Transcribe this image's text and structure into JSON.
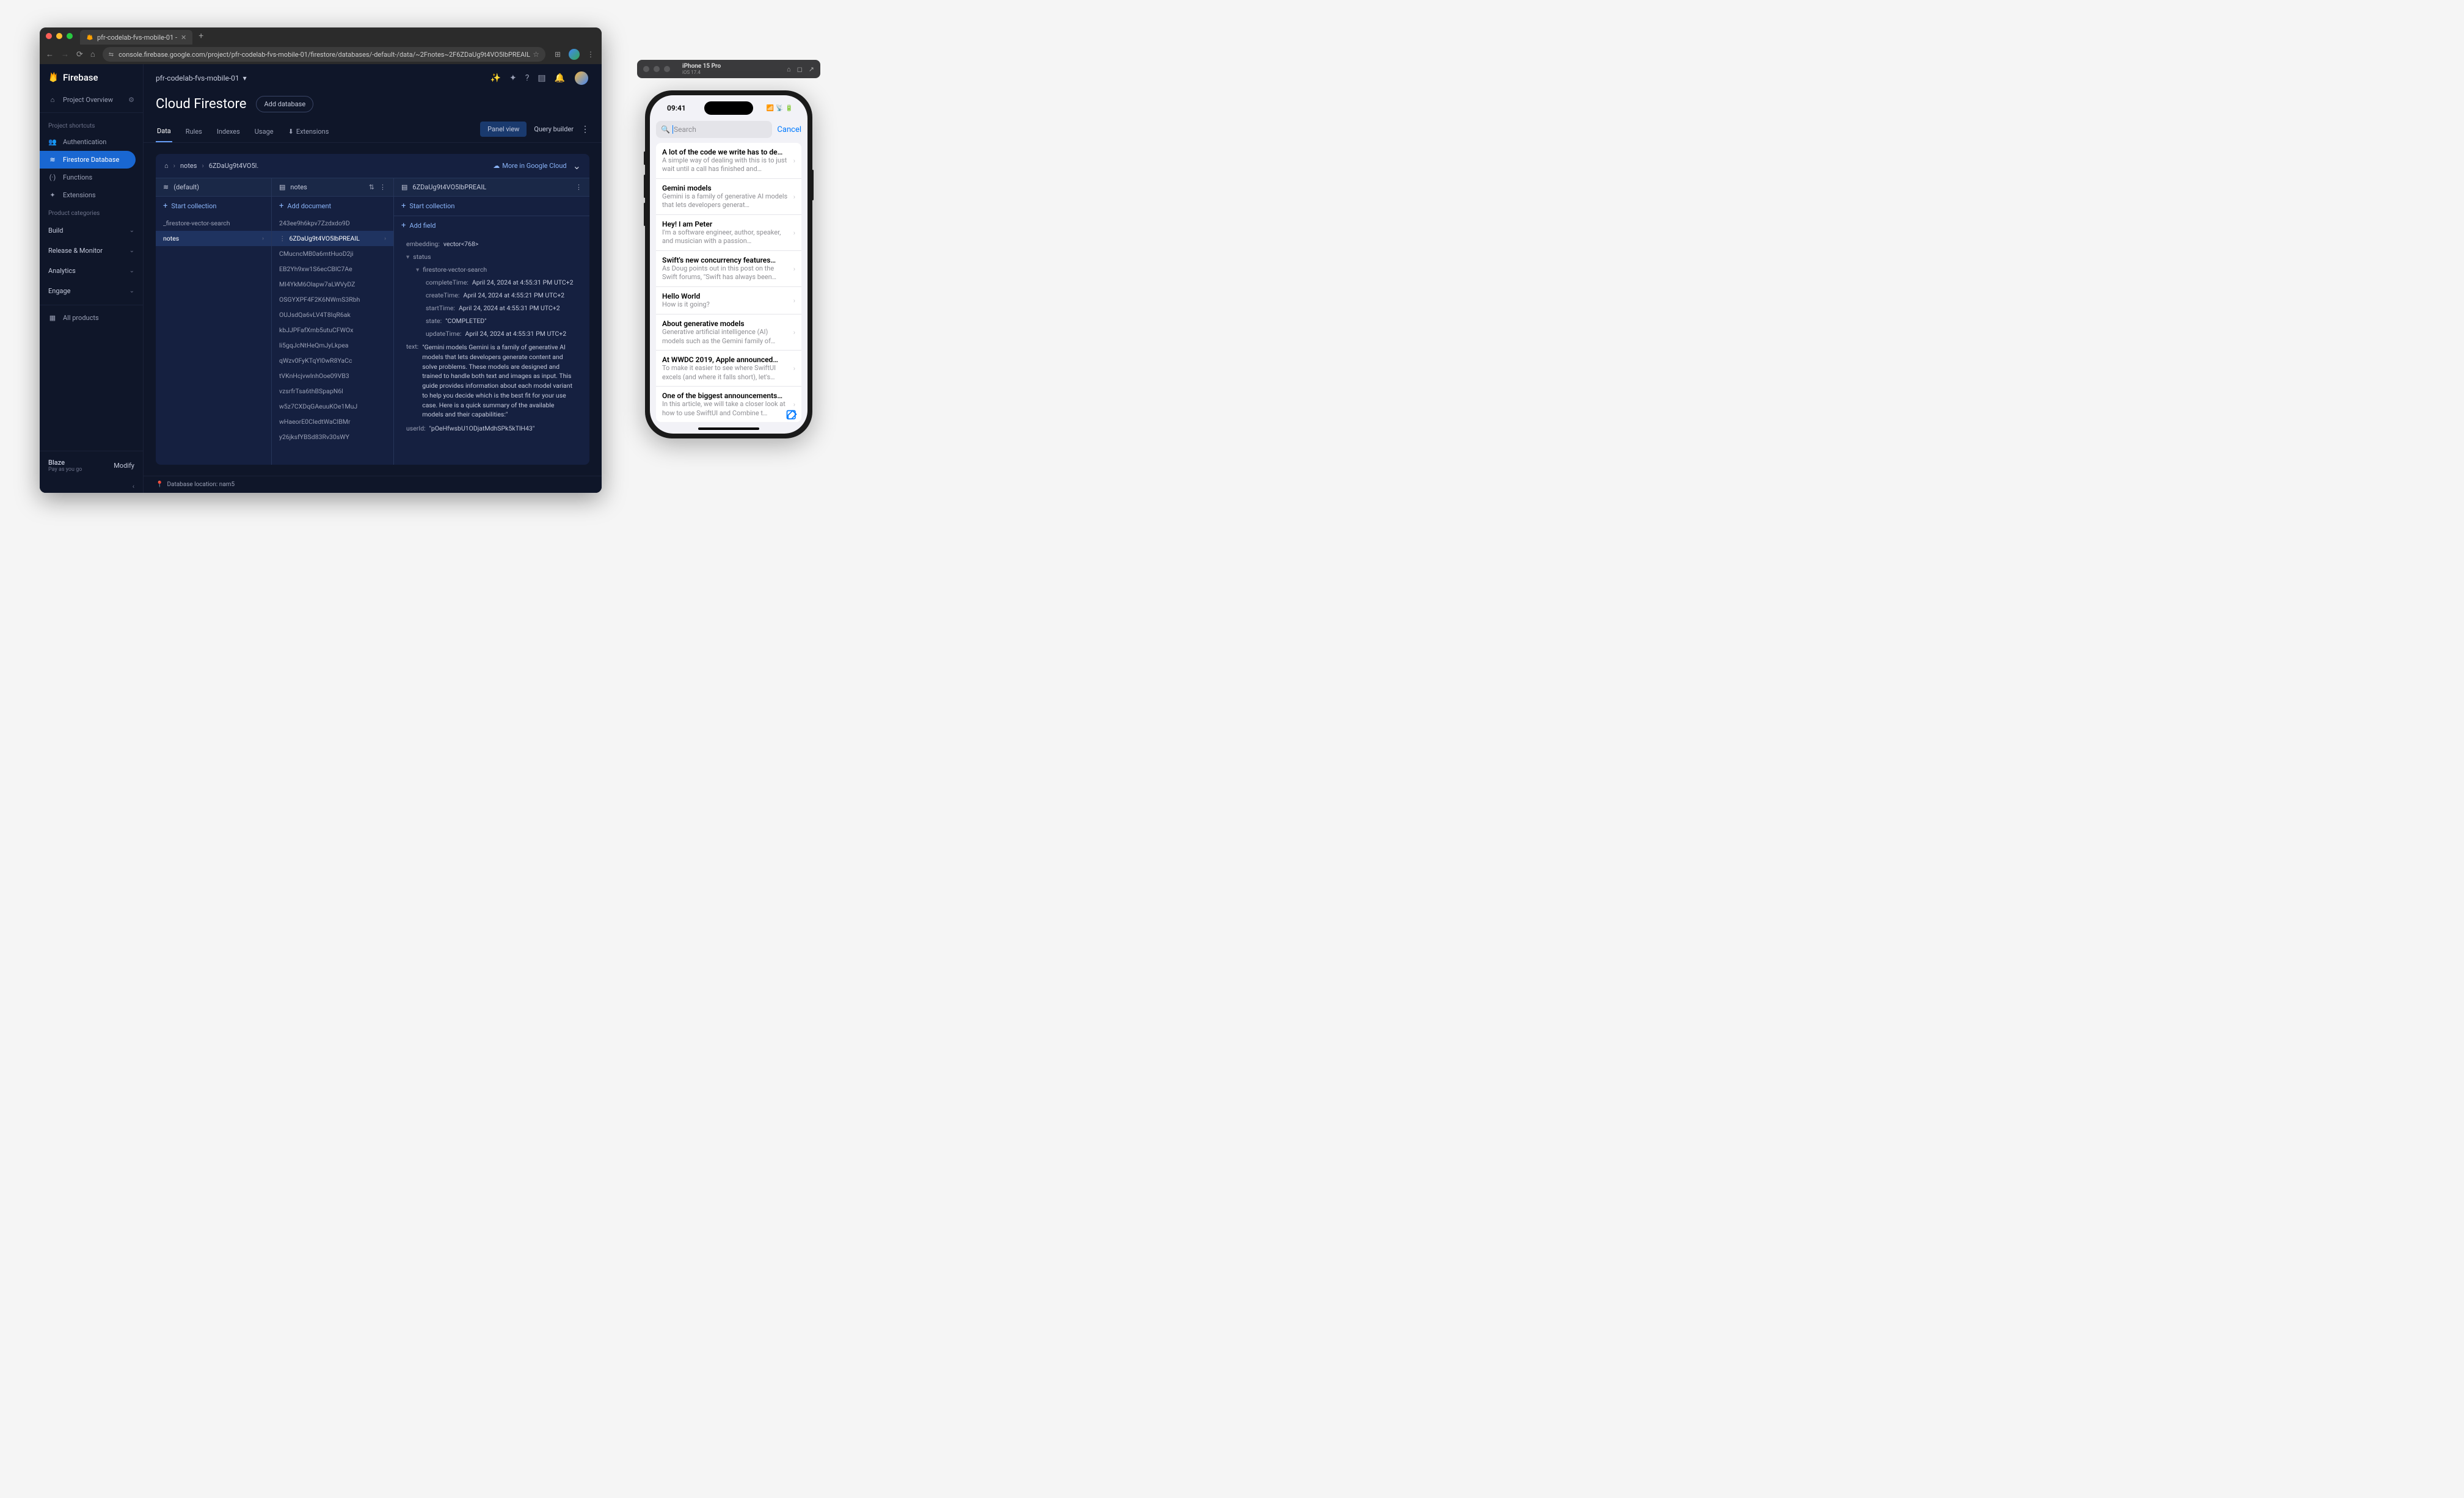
{
  "browser": {
    "tab_title": "pfr-codelab-fvs-mobile-01 -",
    "url": "console.firebase.google.com/project/pfr-codelab-fvs-mobile-01/firestore/databases/-default-/data/~2Fnotes~2F6ZDaUg9t4VO5lbPREAIL"
  },
  "sidebar": {
    "logo_text": "Firebase",
    "overview": "Project Overview",
    "shortcuts_label": "Project shortcuts",
    "shortcuts": [
      {
        "icon": "people",
        "label": "Authentication"
      },
      {
        "icon": "database",
        "label": "Firestore Database"
      },
      {
        "icon": "functions",
        "label": "Functions"
      },
      {
        "icon": "extensions",
        "label": "Extensions"
      }
    ],
    "categories_label": "Product categories",
    "categories": [
      "Build",
      "Release & Monitor",
      "Analytics",
      "Engage"
    ],
    "all_products": "All products",
    "plan": {
      "name": "Blaze",
      "sub": "Pay as you go",
      "modify": "Modify"
    }
  },
  "header": {
    "project": "pfr-codelab-fvs-mobile-01",
    "title": "Cloud Firestore",
    "add_db": "Add database",
    "tabs": [
      "Data",
      "Rules",
      "Indexes",
      "Usage",
      "Extensions"
    ],
    "panel_view": "Panel view",
    "query_builder": "Query builder"
  },
  "breadcrumb": {
    "items": [
      "notes",
      "6ZDaUg9t4VO5l."
    ],
    "cloud_link": "More in Google Cloud"
  },
  "col1": {
    "head": "(default)",
    "action": "Start collection",
    "rows": [
      "_firestore-vector-search",
      "notes"
    ]
  },
  "col2": {
    "head": "notes",
    "action": "Add document",
    "rows": [
      "243ee9h6kpv7Zzdxdo9D",
      "6ZDaUg9t4VO5lbPREAIL",
      "CMucncMB0a6mtHuoD2ji",
      "EB2Yh9xw1S6ecCBlC7Ae",
      "MI4YkM6Olapw7aLWVyDZ",
      "OSGYXPF4F2K6NWmS3Rbh",
      "OUJsdQa6vLV4T8IqR6ak",
      "kbJJPFafXmb5utuCFWOx",
      "li5gqJcNtHeQmJyLkpea",
      "qWzv0FyKTqYl0wR8YaCc",
      "tVKnHcjvwlnhOoe09VB3",
      "vzsrfrTsa6thBSpapN6l",
      "w5z7CXDqGAeuuKOe1MuJ",
      "wHaeorE0CIedtWaCIBMr",
      "y26jksfYBSd83Rv30sWY"
    ]
  },
  "col3": {
    "head": "6ZDaUg9t4VO5lbPREAIL",
    "action1": "Start collection",
    "action2": "Add field",
    "fields": {
      "embedding": "vector<768>",
      "status_label": "status",
      "vector_search": "firestore-vector-search",
      "completeTime": "April 24, 2024 at 4:55:31 PM UTC+2",
      "createTime": "April 24, 2024 at 4:55:21 PM UTC+2",
      "startTime": "April 24, 2024 at 4:55:31 PM UTC+2",
      "state": "\"COMPLETED\"",
      "updateTime": "April 24, 2024 at 4:55:31 PM UTC+2",
      "text": "\"Gemini models Gemini is a family of generative AI models that lets developers generate content and solve problems. These models are designed and trained to handle both text and images as input. This guide provides information about each model variant to help you decide which is the best fit for your use case. Here is a quick summary of the available models and their capabilities:\"",
      "userId": "\"pOeHfwsbU1ODjatMdhSPk5kTlH43\""
    }
  },
  "db_location": "Database location: nam5",
  "simulator": {
    "title": "iPhone 15 Pro",
    "sub": "iOS 17.4",
    "time": "09:41",
    "search_placeholder": "Search",
    "cancel": "Cancel",
    "notes": [
      {
        "title": "A lot of the code we write has to de…",
        "body": "A simple way of dealing with this is to just wait until a call has finished and…"
      },
      {
        "title": "Gemini models",
        "body": "Gemini is a family of generative AI models that lets developers generat…"
      },
      {
        "title": "Hey! I am Peter",
        "body": "I'm a software engineer, author, speaker, and musician with a passion…"
      },
      {
        "title": "Swift's new concurrency features…",
        "body": "As Doug points out in this post on the Swift forums, \"Swift has always been…"
      },
      {
        "title": "Hello World",
        "body": "How is it going?"
      },
      {
        "title": "About generative models",
        "body": "Generative artificial intelligence (AI) models such as the Gemini family of…"
      },
      {
        "title": "At WWDC 2019, Apple announced…",
        "body": "To make it easier to see where SwiftUI excels (and where it falls short), let's…"
      },
      {
        "title": "One of the biggest announcements…",
        "body": "In this article, we will take a closer look at how to use SwiftUI and Combine t…"
      }
    ]
  }
}
